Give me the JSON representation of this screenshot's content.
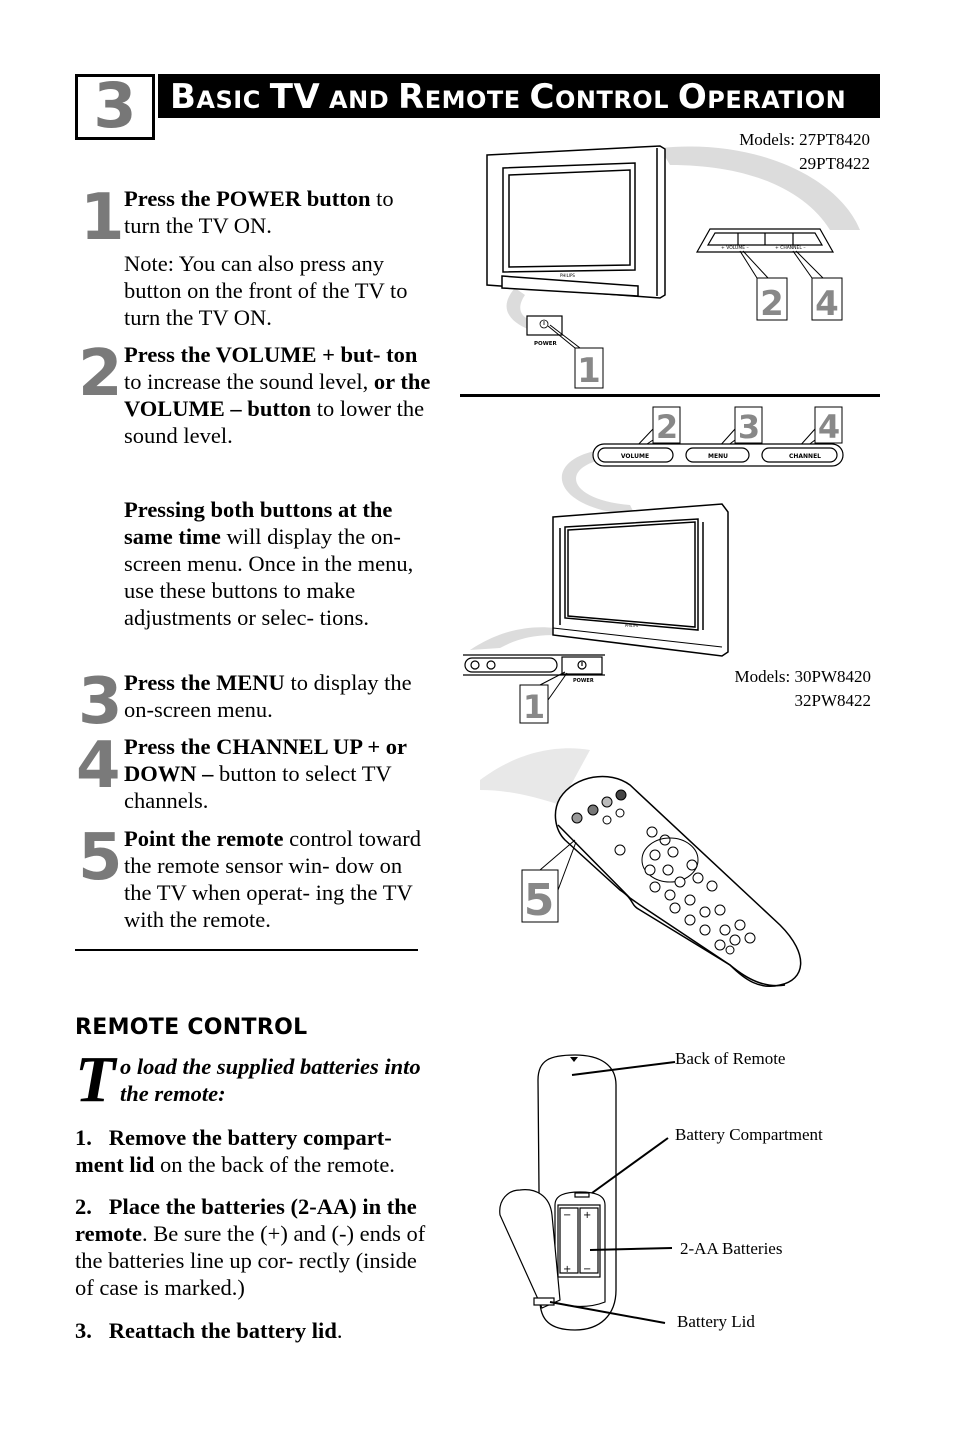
{
  "header": {
    "chapter_number": "3",
    "title_parts": [
      {
        "text": "B",
        "big": true
      },
      {
        "text": "asic ",
        "big": false
      },
      {
        "text": "TV",
        "big": true
      },
      {
        "text": " and ",
        "big": false
      },
      {
        "text": "R",
        "big": true
      },
      {
        "text": "emote ",
        "big": false
      },
      {
        "text": "C",
        "big": true
      },
      {
        "text": "ontrol ",
        "big": false
      },
      {
        "text": "O",
        "big": true
      },
      {
        "text": "peration",
        "big": false
      }
    ]
  },
  "steps": [
    {
      "number": "1",
      "bold": "Press the POWER button",
      "text": " to turn the TV ON."
    },
    {
      "note": "Note: You can also press any button on the front of the TV to turn the TV ON."
    },
    {
      "number": "2",
      "bold1": "Press the VOLUME + but- ton",
      "text1": " to increase the sound level, ",
      "bold2": "or the VOLUME – button",
      "text2": " to lower the sound level."
    },
    {
      "bold": "Pressing both buttons at the same time",
      "text": " will display the on- screen menu. Once in the menu, use these buttons to make adjustments or selec- tions."
    },
    {
      "number": "3",
      "bold": "Press the MENU",
      "text": " to display the on-screen menu."
    },
    {
      "number": "4",
      "bold": "Press the CHANNEL UP + or DOWN  –",
      "text": " button to select TV channels."
    },
    {
      "number": "5",
      "bold": "Point the remote",
      "text": " control toward the remote sensor win- dow on the TV when operat- ing the TV with the remote."
    }
  ],
  "remote_section": {
    "heading": "REMOTE CONTROL",
    "dropcap": "T",
    "intro": "o load the supplied batteries into the remote:",
    "items": [
      {
        "num": "1.",
        "bold": "Remove the battery compart- ment lid",
        "text": " on the back of the remote."
      },
      {
        "num": "2.",
        "bold": "Place the batteries (2-AA) in the remote",
        "text": ". Be sure the (+) and  (-) ends of the batteries line up cor- rectly (inside of case is marked.)"
      },
      {
        "num": "3.",
        "bold": "Reattach the battery lid",
        "text": "."
      }
    ]
  },
  "figure_top": {
    "models_line1": "Models: 27PT8420",
    "models_line2": "29PT8422",
    "panel_volume": "+ VOLUME –",
    "panel_channel": "+ CHANNEL –",
    "power_label": "POWER",
    "brand": "PHILIPS",
    "callouts": [
      "1",
      "2",
      "4"
    ]
  },
  "figure_mid": {
    "buttons": [
      "VOLUME",
      "MENU",
      "CHANNEL"
    ],
    "callouts": [
      "2",
      "3",
      "4",
      "1"
    ],
    "power_label": "POWER",
    "brand": "PHILIPS",
    "models_line1": "Models: 30PW8420",
    "models_line2": "32PW8422"
  },
  "figure_remote": {
    "callout": "5"
  },
  "figure_battery": {
    "labels": [
      "Back of Remote",
      "Battery Compartment",
      "2-AA Batteries",
      "Battery Lid"
    ]
  }
}
